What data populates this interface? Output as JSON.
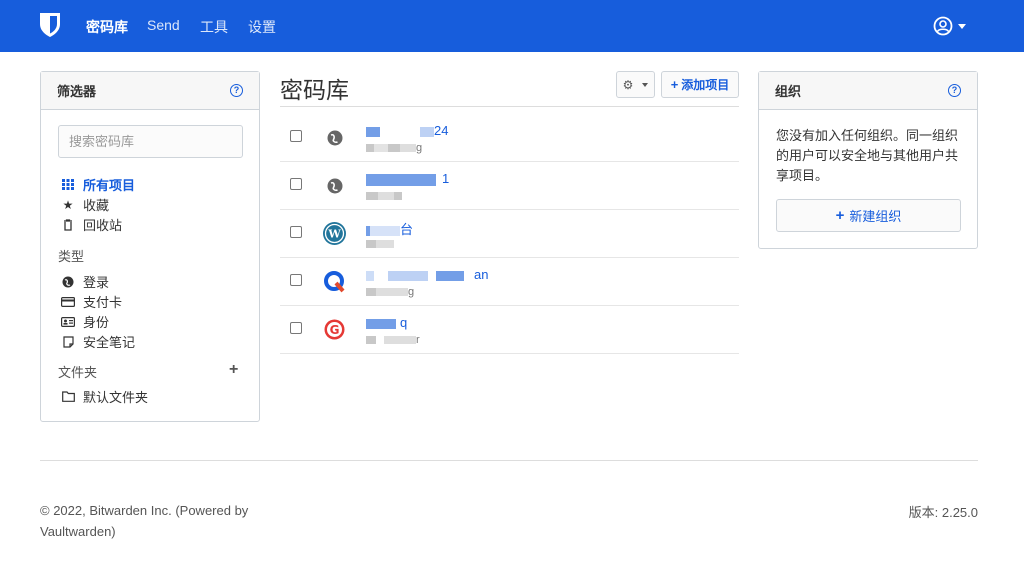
{
  "colors": {
    "brand": "#175ddc",
    "border": "#ced4da"
  },
  "nav": {
    "items": [
      {
        "label": "密码库",
        "active": true
      },
      {
        "label": "Send",
        "active": false
      },
      {
        "label": "工具",
        "active": false
      },
      {
        "label": "设置",
        "active": false
      }
    ],
    "user_icon": "user-circle-icon"
  },
  "filters": {
    "title": "筛选器",
    "search_placeholder": "搜索密码库",
    "all_items": "所有项目",
    "favorites": "收藏",
    "trash": "回收站",
    "types_heading": "类型",
    "types": [
      "登录",
      "支付卡",
      "身份",
      "安全笔记"
    ],
    "folders_heading": "文件夹",
    "default_folder": "默认文件夹"
  },
  "vault": {
    "title": "密码库",
    "add_item_label": "添加项目",
    "rows": [
      {
        "name_tail": "24",
        "sub_tail": "g",
        "icon": "globe-icon"
      },
      {
        "name_tail": "1",
        "sub_tail": "",
        "icon": "globe-icon"
      },
      {
        "name_tail": "台",
        "sub_tail": "",
        "icon": "wordpress-icon"
      },
      {
        "name_tail": "an",
        "sub_tail": "g",
        "icon": "q-logo-icon"
      },
      {
        "name_tail": "q",
        "sub_tail": "r",
        "icon": "g-logo-icon"
      }
    ]
  },
  "org": {
    "title": "组织",
    "description": "您没有加入任何组织。同一组织的用户可以安全地与其他用户共享项目。",
    "new_org_label": "新建组织"
  },
  "footer": {
    "copyright": "© 2022, Bitwarden Inc. (Powered by Vaultwarden)",
    "version": "版本: 2.25.0"
  }
}
